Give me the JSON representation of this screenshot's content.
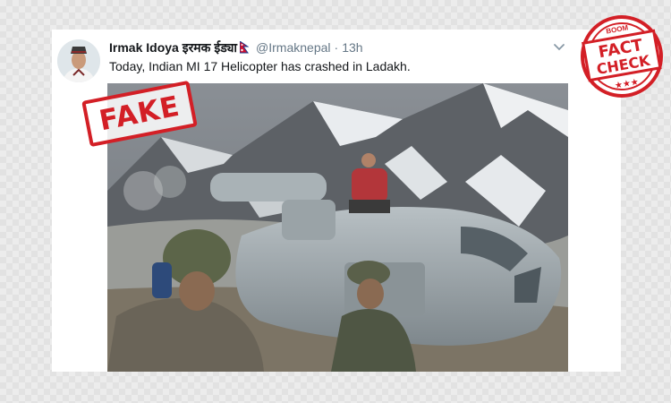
{
  "tweet": {
    "display_name": "Irmak Idoya इरमक ईड्या",
    "handle": "@Irmaknepal",
    "separator": "·",
    "time": "13h",
    "text": "Today, Indian MI 17 Helicopter has crashed in Ladakh.",
    "flag_icon": "nepal-flag-icon",
    "menu_icon": "chevron-down-icon"
  },
  "stamp": {
    "label": "FAKE",
    "color": "#d31f26"
  },
  "badge": {
    "brand": "BOOM",
    "line1": "FACT",
    "line2": "CHECK",
    "stars": "★★★",
    "color": "#d31f26"
  },
  "colors": {
    "text": "#14171a",
    "muted": "#657786",
    "accent_red": "#d31f26"
  }
}
